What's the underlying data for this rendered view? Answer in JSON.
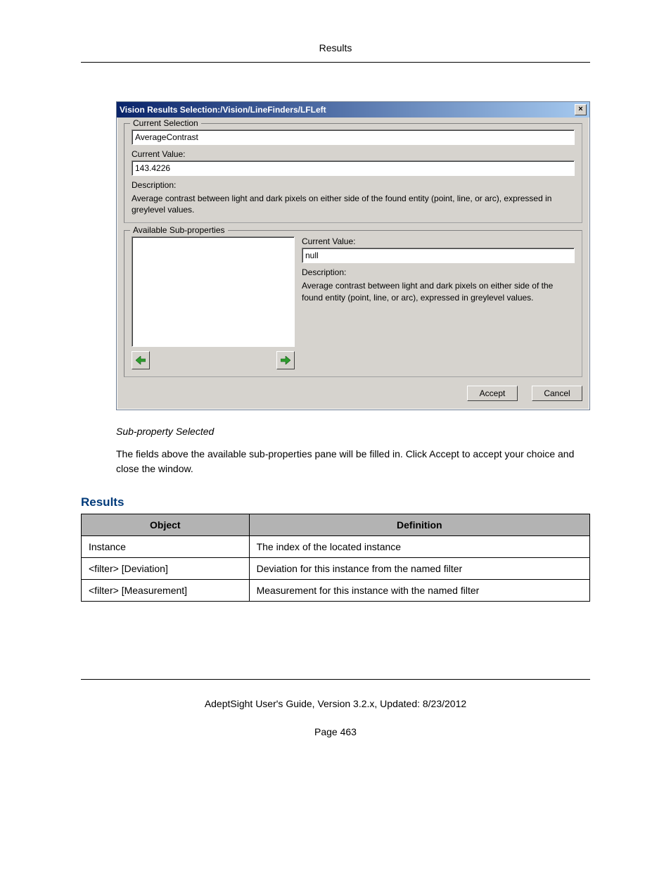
{
  "header": {
    "title": "Results"
  },
  "dialog": {
    "title": "Vision Results Selection:/Vision/LineFinders/LFLeft",
    "close": "×",
    "current_selection": {
      "legend": "Current Selection",
      "name": "AverageContrast",
      "current_value_label": "Current Value:",
      "current_value": "143.4226",
      "description_label": "Description:",
      "description": "Average contrast between light and dark pixels on either side of the found entity (point, line, or arc), expressed in greylevel values."
    },
    "sub_properties": {
      "legend": "Available Sub-properties",
      "current_value_label": "Current Value:",
      "current_value": "null",
      "description_label": "Description:",
      "description": "Average contrast between light and dark pixels on either side of the found entity (point, line, or arc), expressed in greylevel values."
    },
    "buttons": {
      "accept": "Accept",
      "cancel": "Cancel"
    }
  },
  "caption": "Sub-property Selected",
  "body_text": "The fields above the available sub-properties pane will be filled in. Click Accept to accept your choice and close the window.",
  "results_heading": "Results",
  "table": {
    "headers": {
      "object": "Object",
      "definition": "Definition"
    },
    "rows": [
      {
        "object": "Instance",
        "definition": "The index of the located instance"
      },
      {
        "object": "<filter> [Deviation]",
        "definition": "Deviation for this instance from the named filter"
      },
      {
        "object": "<filter> [Measurement]",
        "definition": "Measurement for this instance with the named filter"
      }
    ]
  },
  "footer": {
    "line": "AdeptSight User's Guide,  Version 3.2.x, Updated: 8/23/2012",
    "page": "Page 463"
  }
}
